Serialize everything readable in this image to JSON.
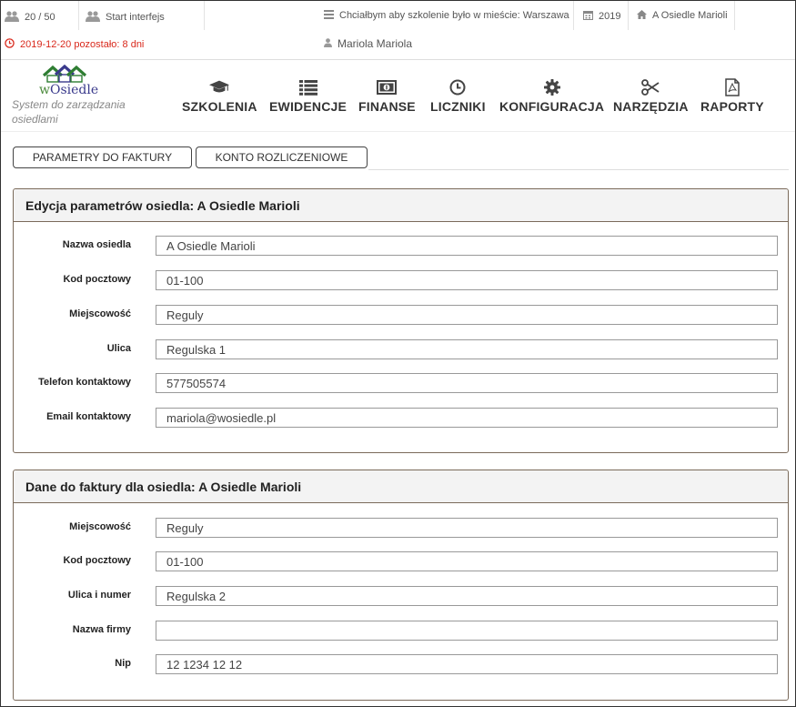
{
  "topbar": {
    "users_count": "20 / 50",
    "start_label": "Start interfejs",
    "training_city": "Chciałbym aby szkolenie było w mieście: Warszawa",
    "year": "2019",
    "estate": "A Osiedle Marioli",
    "expiry": "2019-12-20 pozostało: 8 dni",
    "user_name": "Mariola Mariola"
  },
  "brand": {
    "logo_w": "w",
    "logo_rest": "Osiedle",
    "tagline": "System do zarządzania osiedlami",
    "colors": {
      "roof_left": "#2e7d32",
      "roof_mid": "#3a3a8c",
      "roof_right": "#2e7d32"
    }
  },
  "nav": [
    {
      "label": "SZKOLENIA",
      "icon": "graduation-cap-icon"
    },
    {
      "label": "EWIDENCJE",
      "icon": "list-icon"
    },
    {
      "label": "FINANSE",
      "icon": "money-icon"
    },
    {
      "label": "LICZNIKI",
      "icon": "clock-icon"
    },
    {
      "label": "KONFIGURACJA",
      "icon": "gear-icon"
    },
    {
      "label": "NARZĘDZIA",
      "icon": "scissors-icon"
    },
    {
      "label": "RAPORTY",
      "icon": "pdf-icon"
    }
  ],
  "tabs": {
    "invoice_params": "PARAMETRY DO FAKTURY",
    "settlement_account": "KONTO ROZLICZENIOWE"
  },
  "panel1": {
    "title": "Edycja parametrów osiedla: A Osiedle Marioli",
    "fields": [
      {
        "label": "Nazwa osiedla",
        "value": "A Osiedle Marioli"
      },
      {
        "label": "Kod pocztowy",
        "value": "01-100"
      },
      {
        "label": "Miejscowość",
        "value": "Reguly"
      },
      {
        "label": "Ulica",
        "value": "Regulska 1"
      },
      {
        "label": "Telefon kontaktowy",
        "value": "577505574"
      },
      {
        "label": "Email kontaktowy",
        "value": "mariola@wosiedle.pl"
      }
    ]
  },
  "panel2": {
    "title": "Dane do faktury dla osiedla: A Osiedle Marioli",
    "fields": [
      {
        "label": "Miejscowość",
        "value": "Reguly"
      },
      {
        "label": "Kod pocztowy",
        "value": "01-100"
      },
      {
        "label": "Ulica i numer",
        "value": "Regulska 2"
      },
      {
        "label": "Nazwa firmy",
        "value": ""
      },
      {
        "label": "Nip",
        "value": "12 1234 12 12"
      }
    ]
  },
  "colors": {
    "warning": "#d9291c",
    "panel_border": "#7a6a5a"
  }
}
